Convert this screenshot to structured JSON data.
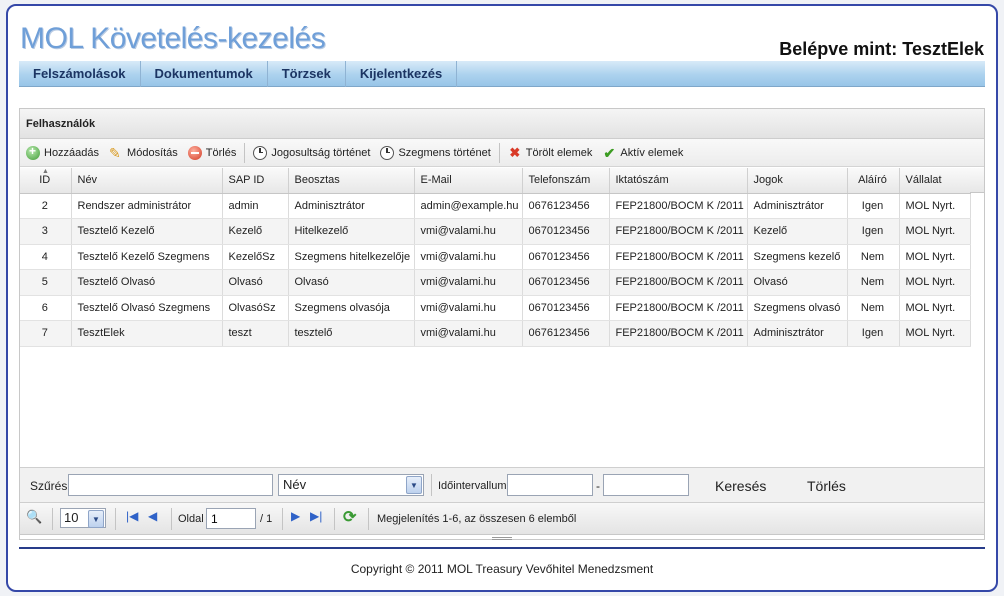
{
  "header": {
    "app_title": "MOL Követelés-kezelés",
    "logged_in": "Belépve mint: TesztElek"
  },
  "menu": [
    "Felszámolások",
    "Dokumentumok",
    "Törzsek",
    "Kijelentkezés"
  ],
  "panel": {
    "title": "Felhasználók"
  },
  "toolbar": {
    "add": "Hozzáadás",
    "edit": "Módosítás",
    "delete": "Törlés",
    "rights_history": "Jogosultság történet",
    "segment_history": "Szegmens történet",
    "deleted_items": "Törölt elemek",
    "active_items": "Aktív elemek"
  },
  "table": {
    "columns": [
      "ID",
      "Név",
      "SAP ID",
      "Beosztas",
      "E-Mail",
      "Telefonszám",
      "Iktatószám",
      "Jogok",
      "Aláíró",
      "Vállalat"
    ],
    "rows": [
      [
        "2",
        "Rendszer administrátor",
        "admin",
        "Adminisztrátor",
        "admin@example.hu",
        "0676123456",
        "FEP21800/BOCM K /2011",
        "Adminisztrátor",
        "Igen",
        "MOL Nyrt."
      ],
      [
        "3",
        "Tesztelő Kezelő",
        "Kezelő",
        "Hitelkezelő",
        "vmi@valami.hu",
        "0670123456",
        "FEP21800/BOCM K /2011",
        "Kezelő",
        "Igen",
        "MOL Nyrt."
      ],
      [
        "4",
        "Tesztelő Kezelő Szegmens",
        "KezelőSz",
        "Szegmens hitelkezelője",
        "vmi@valami.hu",
        "0670123456",
        "FEP21800/BOCM K /2011",
        "Szegmens kezelő",
        "Nem",
        "MOL Nyrt."
      ],
      [
        "5",
        "Tesztelő Olvasó",
        "Olvasó",
        "Olvasó",
        "vmi@valami.hu",
        "0670123456",
        "FEP21800/BOCM K /2011",
        "Olvasó",
        "Nem",
        "MOL Nyrt."
      ],
      [
        "6",
        "Tesztelő Olvasó Szegmens",
        "OlvasóSz",
        "Szegmens olvasója",
        "vmi@valami.hu",
        "0670123456",
        "FEP21800/BOCM K /2011",
        "Szegmens olvasó",
        "Nem",
        "MOL Nyrt."
      ],
      [
        "7",
        "TesztElek",
        "teszt",
        "tesztelő",
        "vmi@valami.hu",
        "0676123456",
        "FEP21800/BOCM K /2011",
        "Adminisztrátor",
        "Igen",
        "MOL Nyrt."
      ]
    ]
  },
  "filter": {
    "label": "Szűrés",
    "value": "",
    "field_selected": "Név",
    "interval_label": "Időintervallum",
    "from": "",
    "dash": "-",
    "to": "",
    "search": "Keresés",
    "clear": "Törlés"
  },
  "pager": {
    "page_size": "10",
    "page_label": "Oldal",
    "page": "1",
    "of": "/ 1",
    "status": "Megjelenítés 1-6, az összesen 6 elemből"
  },
  "footer": {
    "copyright": "Copyright © 2011 MOL Treasury Vevőhitel Menedzsment"
  },
  "icons": {
    "add": "add-circle-icon",
    "edit": "pencil-icon",
    "delete": "minus-circle-icon",
    "history": "clock-icon",
    "deleted": "x-icon",
    "active": "check-icon",
    "search": "magnifier-icon",
    "refresh": "refresh-icon"
  },
  "colors": {
    "title": "#6f9fd8",
    "menu_bg": "#acd2ee",
    "frame_border": "#3548a8"
  }
}
